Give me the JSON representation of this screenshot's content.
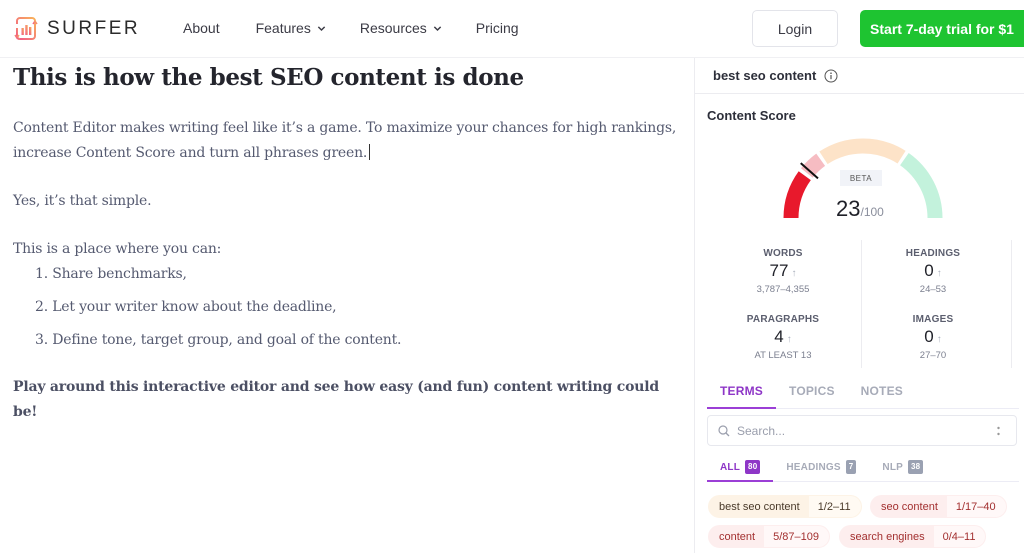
{
  "header": {
    "brand": "SURFER",
    "nav": [
      {
        "label": "About",
        "has_dropdown": false
      },
      {
        "label": "Features",
        "has_dropdown": true
      },
      {
        "label": "Resources",
        "has_dropdown": true
      },
      {
        "label": "Pricing",
        "has_dropdown": false
      }
    ],
    "login_label": "Login",
    "trial_label": "Start 7-day trial for $1",
    "trial_color": "#1ec431"
  },
  "editor": {
    "title": "This is how the best SEO content is done",
    "paragraph1": "Content Editor makes writing feel like it’s a game. To maximize your chances for high rankings, increase Content Score and turn all phrases green.",
    "paragraph2": "Yes, it’s that simple.",
    "paragraph3": "This is a place where you can:",
    "list": [
      "1. Share benchmarks,",
      "2. Let your writer know about the deadline,",
      "3. Define tone, target group, and goal of the content."
    ],
    "closing": "Play around this interactive editor and see how easy (and fun) content writing could be!"
  },
  "panel": {
    "keyword": "best seo content",
    "content_score": {
      "title": "Content Score",
      "badge": "BETA",
      "value": "23",
      "max": "/100",
      "score_fraction": 0.23,
      "segment_colors": [
        "#e8192c",
        "#f6bcc2",
        "#fde3c8",
        "#c3f2dc"
      ]
    },
    "stats": [
      {
        "label": "WORDS",
        "value": "77",
        "range": "3,787–4,355"
      },
      {
        "label": "HEADINGS",
        "value": "0",
        "range": "24–53"
      },
      {
        "label": "PARAGRAPHS",
        "value": "4",
        "range": "AT LEAST 13"
      },
      {
        "label": "IMAGES",
        "value": "0",
        "range": "27–70"
      }
    ],
    "tabs": [
      {
        "label": "TERMS",
        "active": true
      },
      {
        "label": "TOPICS",
        "active": false
      },
      {
        "label": "NOTES",
        "active": false
      }
    ],
    "search_placeholder": "Search...",
    "subtabs": [
      {
        "label": "ALL",
        "count": "80",
        "active": true
      },
      {
        "label": "HEADINGS",
        "count": "7",
        "active": false
      },
      {
        "label": "NLP",
        "count": "38",
        "active": false
      }
    ],
    "terms": [
      {
        "term": "best seo content",
        "count": "1/2–11",
        "status": "orange"
      },
      {
        "term": "seo content",
        "count": "1/17–40",
        "status": "red"
      },
      {
        "term": "content",
        "count": "5/87–109",
        "status": "red"
      },
      {
        "term": "search engines",
        "count": "0/4–11",
        "status": "red"
      }
    ],
    "accent_color": "#8e36c7"
  }
}
